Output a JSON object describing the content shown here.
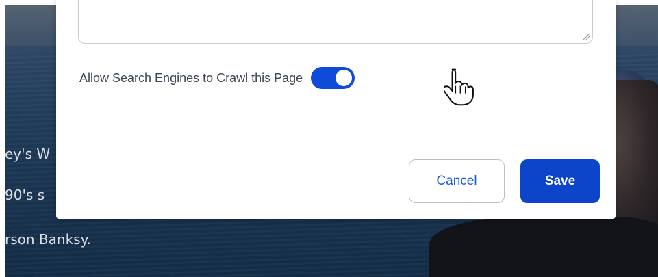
{
  "background_page": {
    "text_lines": [
      "ey's W",
      "90's s",
      "rson Banksy."
    ]
  },
  "modal": {
    "textarea": {
      "value": "",
      "placeholder": ""
    },
    "crawl_setting": {
      "label": "Allow Search Engines to Crawl this Page",
      "enabled": true
    },
    "buttons": {
      "cancel_label": "Cancel",
      "save_label": "Save"
    }
  },
  "icons": {
    "cursor": "hand-pointer-icon",
    "resize": "resize-grip-icon"
  },
  "colors": {
    "toggle_on": "#0e4bd8",
    "save_button": "#0c45c9",
    "cancel_text": "#1a5bd6",
    "label_text": "#3d4651"
  }
}
